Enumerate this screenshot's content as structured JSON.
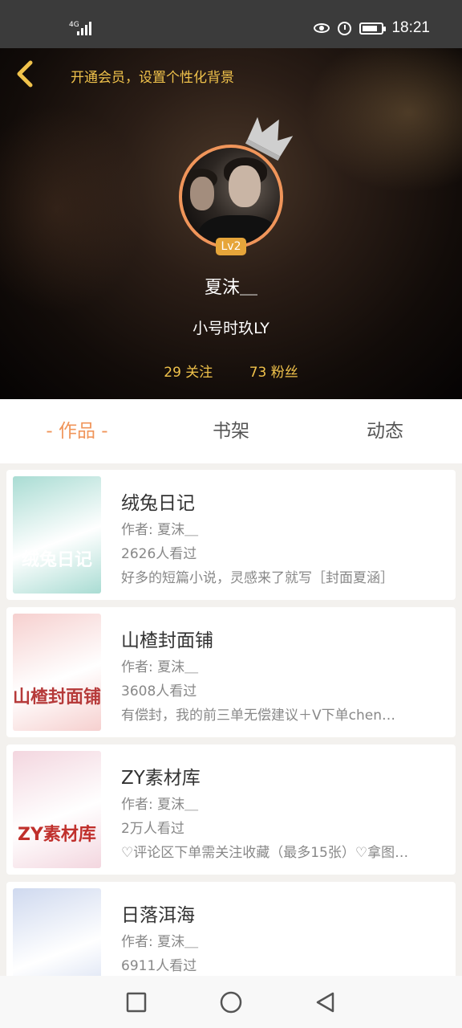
{
  "status_bar": {
    "network": "4G",
    "time": "18:21"
  },
  "header": {
    "vip_prompt": "开通会员，设置个性化背景",
    "level": "Lv2",
    "username": "夏沫＿",
    "nickname": "小号时玖LY",
    "following": "29 关注",
    "followers": "73 粉丝"
  },
  "tabs": [
    {
      "label": "- 作品 -",
      "active": true
    },
    {
      "label": "书架",
      "active": false
    },
    {
      "label": "动态",
      "active": false
    }
  ],
  "works": [
    {
      "title": "绒兔日记",
      "author": "作者: 夏沫＿",
      "views": "2626人看过",
      "desc": "好多的短篇小说，灵感来了就写［封面夏涵］",
      "cover_text": "绒兔日记",
      "cover_bg": "#a9dcd3",
      "cover_text_color": "#ffffff"
    },
    {
      "title": "山楂封面铺",
      "author": "作者: 夏沫＿",
      "views": "3608人看过",
      "desc": "有偿封，我的前三单无偿建议＋V下单chen…",
      "cover_text": "山楂封面铺",
      "cover_bg": "#f6d0cf",
      "cover_text_color": "#b63a3a"
    },
    {
      "title": "ZY素材库",
      "author": "作者: 夏沫＿",
      "views": "2万人看过",
      "desc": "♡评论区下单需关注收藏（最多15张）♡拿图…",
      "cover_text": "ZY素材库",
      "cover_bg": "#f3d6df",
      "cover_text_color": "#c0302c"
    },
    {
      "title": "日落洱海",
      "author": "作者: 夏沫＿",
      "views": "6911人看过",
      "desc": "",
      "cover_text": "",
      "cover_bg": "#cfd9ef",
      "cover_text_color": "#3a5aa8"
    }
  ],
  "colors": {
    "accent": "#f0955a",
    "gold": "#f0c24b"
  }
}
